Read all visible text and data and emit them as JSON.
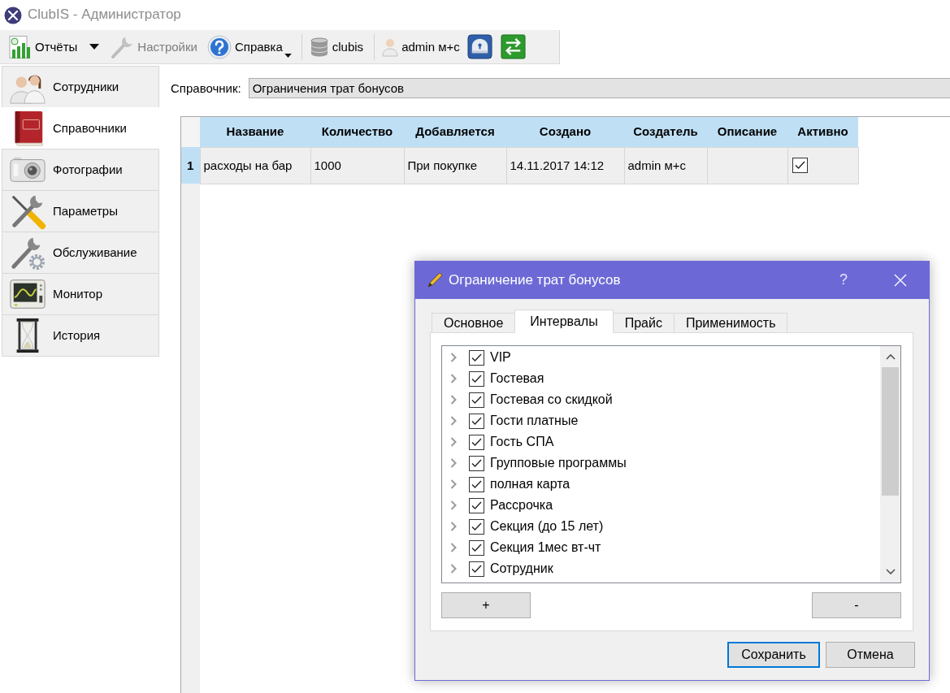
{
  "window": {
    "title": "ClubIS - Администратор"
  },
  "toolbar": {
    "groups": [
      [
        {
          "kind": "split",
          "label": "Отчёты",
          "disabled": false
        },
        {
          "kind": "button",
          "label": "Настройки",
          "disabled": true
        },
        {
          "kind": "menu",
          "label": "Справка",
          "disabled": false
        }
      ],
      [
        {
          "kind": "button",
          "label": "clubis",
          "disabled": false
        }
      ],
      [
        {
          "kind": "button",
          "label": "admin м+с",
          "disabled": false
        },
        {
          "kind": "icon",
          "disabled": false
        },
        {
          "kind": "icon",
          "disabled": false
        }
      ]
    ]
  },
  "sidebar": {
    "items": [
      {
        "label": "Сотрудники",
        "selected": false
      },
      {
        "label": "Справочники",
        "selected": true
      },
      {
        "label": "Фотографии",
        "selected": false
      },
      {
        "label": "Параметры",
        "selected": false
      },
      {
        "label": "Обслуживание",
        "selected": false
      },
      {
        "label": "Монитор",
        "selected": false
      },
      {
        "label": "История",
        "selected": false
      }
    ]
  },
  "directory": {
    "label": "Справочник:",
    "value": "Ограничения трат бонусов"
  },
  "table": {
    "columns": [
      "Название",
      "Количество",
      "Добавляется",
      "Создано",
      "Создатель",
      "Описание",
      "Активно"
    ],
    "rows": [
      {
        "number": "1",
        "name": "расходы на бар",
        "quantity": "1000",
        "added": "При покупке",
        "created": "14.11.2017 14:12",
        "creator": "admin м+с",
        "active": true
      }
    ]
  },
  "dialog": {
    "title": "Ограничение трат бонусов",
    "help": "?",
    "tabs": [
      {
        "label": "Основное",
        "selected": false
      },
      {
        "label": "Интервалы",
        "selected": true
      },
      {
        "label": "Прайс",
        "selected": false
      },
      {
        "label": "Применимость",
        "selected": false
      }
    ],
    "tree": {
      "items": [
        {
          "label": "VIP",
          "checked": true,
          "expanded": false
        },
        {
          "label": "Гостевая",
          "checked": true,
          "expanded": false
        },
        {
          "label": "Гостевая со скидкой",
          "checked": true,
          "expanded": false
        },
        {
          "label": "Гости платные",
          "checked": true,
          "expanded": false
        },
        {
          "label": "Гость СПА",
          "checked": true,
          "expanded": false
        },
        {
          "label": "Групповые программы",
          "checked": true,
          "expanded": false
        },
        {
          "label": "полная карта",
          "checked": true,
          "expanded": false
        },
        {
          "label": "Рассрочка",
          "checked": true,
          "expanded": false
        },
        {
          "label": "Секция (до 15 лет)",
          "checked": true,
          "expanded": false
        },
        {
          "label": "Секция 1мес вт-чт",
          "checked": true,
          "expanded": false
        },
        {
          "label": "Сотрудник",
          "checked": true,
          "expanded": false
        }
      ]
    },
    "list_buttons": [
      "+",
      "-"
    ],
    "buttons": [
      {
        "label": "Сохранить",
        "default": true
      },
      {
        "label": "Отмена",
        "default": false
      }
    ]
  }
}
